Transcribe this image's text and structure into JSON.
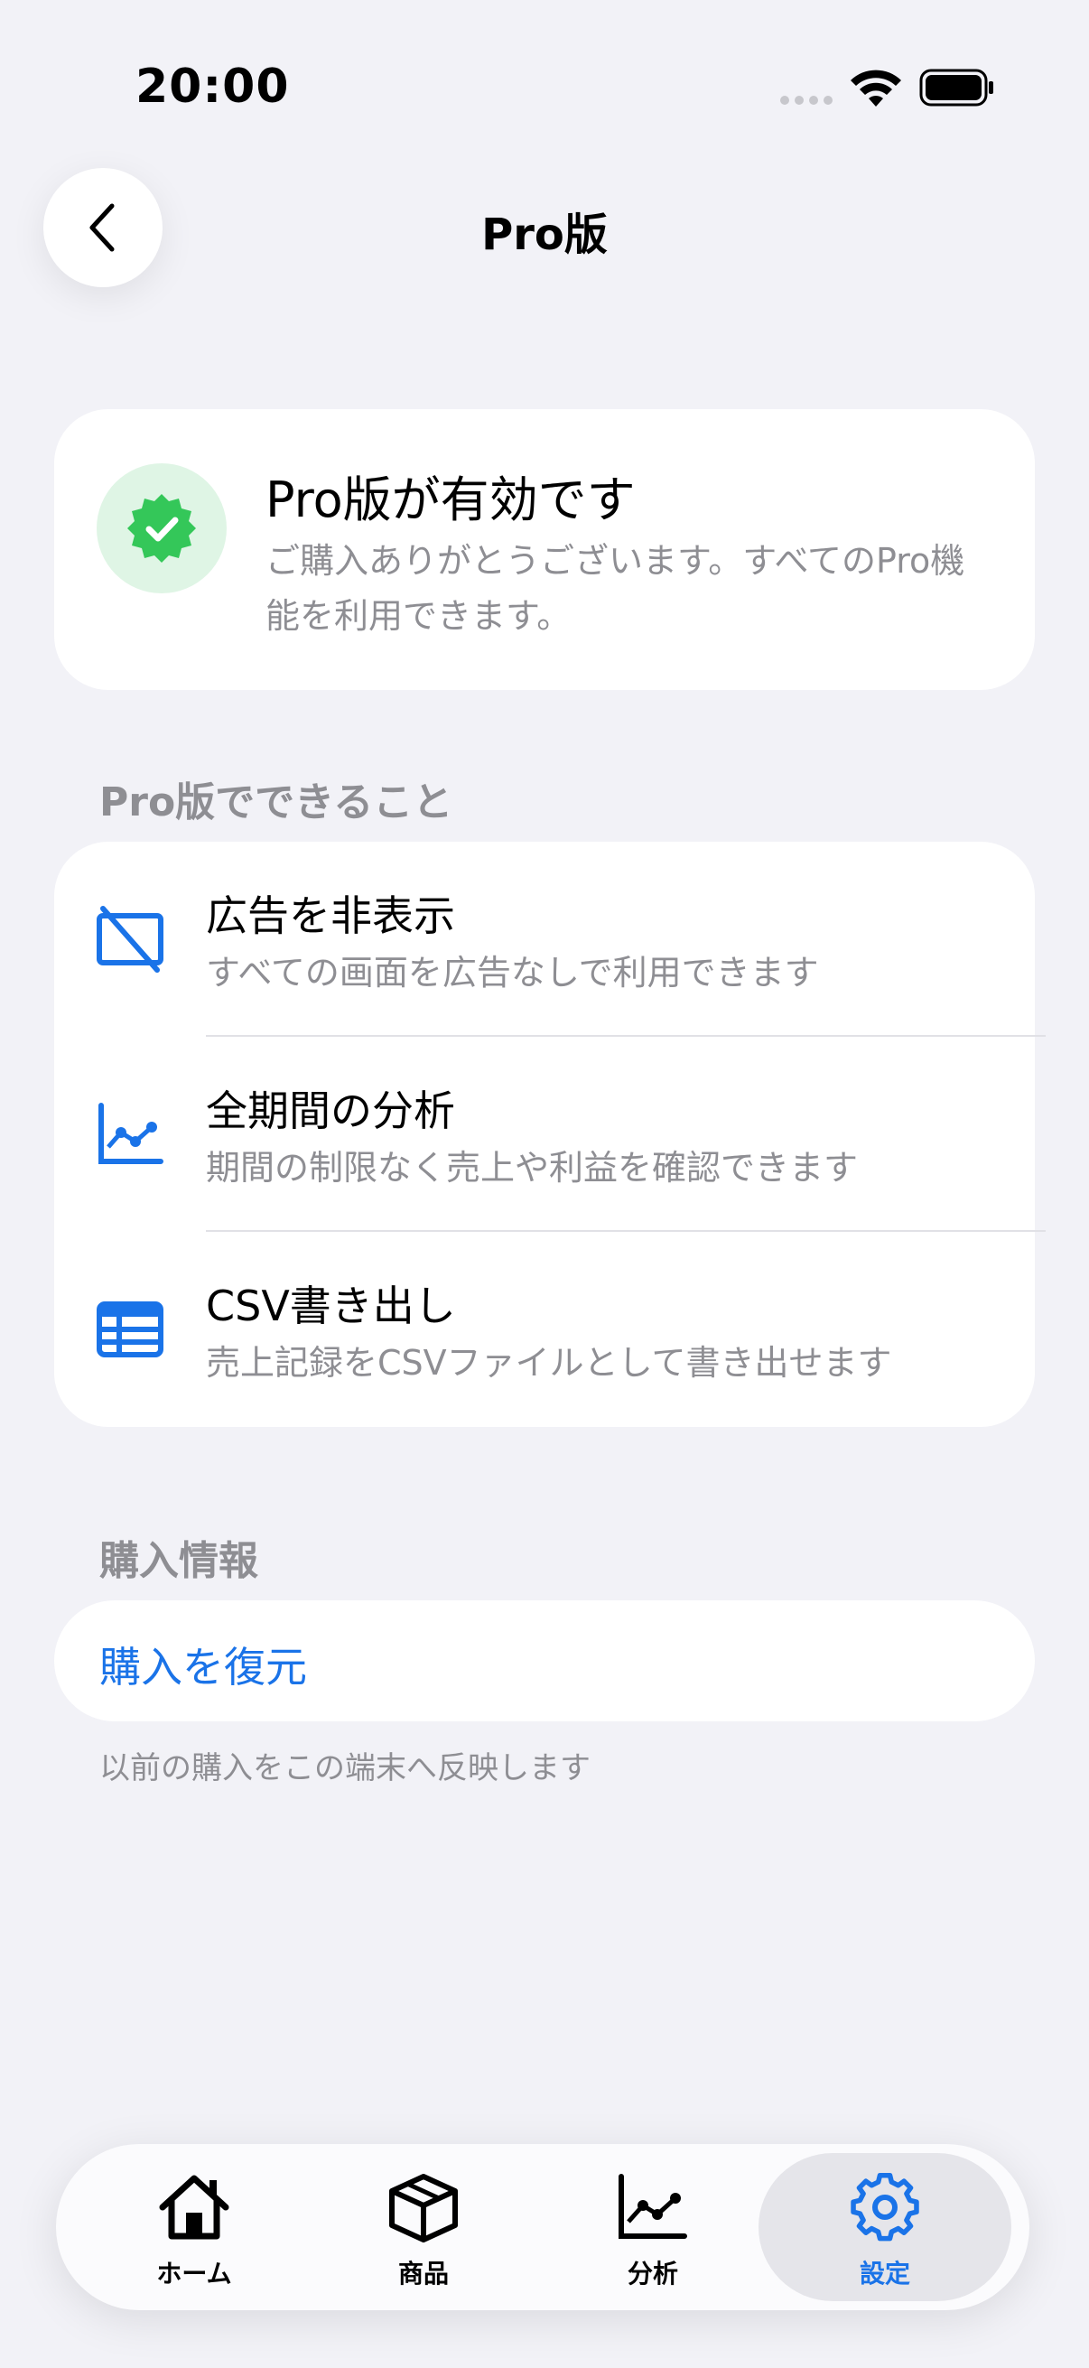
{
  "status_bar": {
    "time": "20:00"
  },
  "nav": {
    "title": "Pro版"
  },
  "pro_status": {
    "title": "Pro版が有効です",
    "description": "ご購入ありがとうございます。すべてのPro機能を利用できます。"
  },
  "features_section": {
    "header": "Pro版でできること",
    "items": [
      {
        "icon": "no-ads-icon",
        "title": "広告を非表示",
        "subtitle": "すべての画面を広告なしで利用できます"
      },
      {
        "icon": "chart-line-icon",
        "title": "全期間の分析",
        "subtitle": "期間の制限なく売上や利益を確認できます"
      },
      {
        "icon": "table-icon",
        "title": "CSV書き出し",
        "subtitle": "売上記録をCSVファイルとして書き出せます"
      }
    ]
  },
  "purchase_section": {
    "header": "購入情報",
    "restore_label": "購入を復元",
    "footnote": "以前の購入をこの端末へ反映します"
  },
  "tab_bar": {
    "tabs": [
      {
        "icon": "house-icon",
        "label": "ホーム",
        "active": false
      },
      {
        "icon": "box-icon",
        "label": "商品",
        "active": false
      },
      {
        "icon": "chart-icon",
        "label": "分析",
        "active": false
      },
      {
        "icon": "gear-icon",
        "label": "設定",
        "active": true
      }
    ]
  },
  "colors": {
    "accent": "#1a73e8",
    "success": "#34c759",
    "background": "#f2f2f7",
    "secondary_text": "#8e8e93"
  }
}
